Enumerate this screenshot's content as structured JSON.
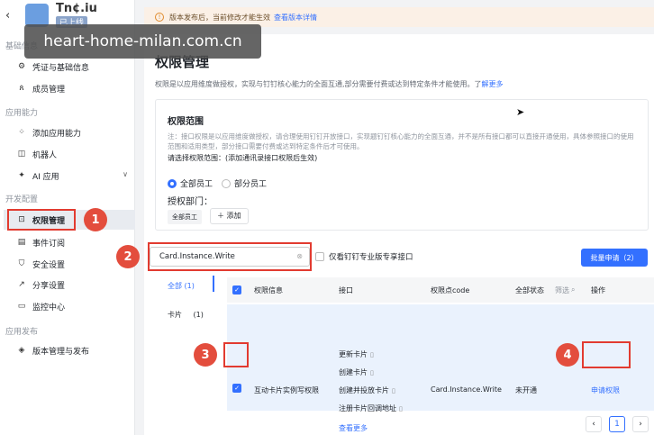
{
  "sidebar": {
    "back_icon": "chevron-left-icon",
    "app_name": "Tn¢.iu",
    "app_status": "已上线",
    "sections": [
      {
        "title": "基础信息"
      },
      {
        "title": "应用能力"
      },
      {
        "title": "开发配置"
      },
      {
        "title": "应用发布"
      }
    ],
    "items": [
      {
        "label": "凭证与基础信息",
        "icon": "gear-icon"
      },
      {
        "label": "成员管理",
        "icon": "user-icon"
      },
      {
        "label": "添加应用能力",
        "icon": "grid-icon"
      },
      {
        "label": "机器人",
        "icon": "robot-icon"
      },
      {
        "label": "AI 应用",
        "icon": "ai-icon"
      },
      {
        "label": "权限管理",
        "icon": "lock-icon"
      },
      {
        "label": "事件订阅",
        "icon": "calendar-icon"
      },
      {
        "label": "安全设置",
        "icon": "shield-icon"
      },
      {
        "label": "分享设置",
        "icon": "share-icon"
      },
      {
        "label": "监控中心",
        "icon": "monitor-icon"
      },
      {
        "label": "版本管理与发布",
        "icon": "layers-icon"
      }
    ]
  },
  "watermark": "heart-home-milan.com.cn",
  "notice": {
    "text": "版本发布后，当前修改才能生效",
    "link": "查看版本详情"
  },
  "page": {
    "title": "权限管理",
    "desc": "权限是以应用维度做授权，实现与钉钉核心能力的全面互通,部分需要付费或达到特定条件才能使用。了",
    "desc_link": "解更多"
  },
  "scope": {
    "title": "权限范围",
    "note": "注：接口权限是以应用维度做授权，请合理使用钉钉开放接口，实现题钉钉核心能力的全面互通，并不是所有接口都可以直接开通使用，具体参照接口的使用范围和适用类型，部分接口需要付费或达到特定条件后才可使用。",
    "select_label": "请选择权限范围：(添加通讯录接口权限后生效)",
    "radio_all": "全部员工",
    "radio_part": "部分员工",
    "auth_label": "授权部门：",
    "tag": "全部员工",
    "add_btn": "＋ 添加"
  },
  "toolbar": {
    "search_value": "Card.Instance.Write",
    "only_label": "仅看钉钉专业版专享接口",
    "batch_btn": "批量申请（2）"
  },
  "tabs": [
    {
      "label": "全部",
      "count": "(1)"
    },
    {
      "label": "卡片",
      "count": "(1)"
    }
  ],
  "table": {
    "headers": [
      "权限信息",
      "接口",
      "权限点code",
      "全部状态",
      "筛选",
      "操作"
    ],
    "row": {
      "name": "互动卡片实例写权限",
      "interfaces": [
        "更新卡片",
        "创建卡片",
        "创建并投放卡片",
        "注册卡片回调地址"
      ],
      "more": "查看更多",
      "code": "Card.Instance.Write",
      "status": "未开通",
      "action": "申请权限"
    }
  },
  "pager": {
    "prev": "‹",
    "page": "1",
    "next": "›"
  },
  "badges": [
    "1",
    "2",
    "3",
    "4"
  ]
}
